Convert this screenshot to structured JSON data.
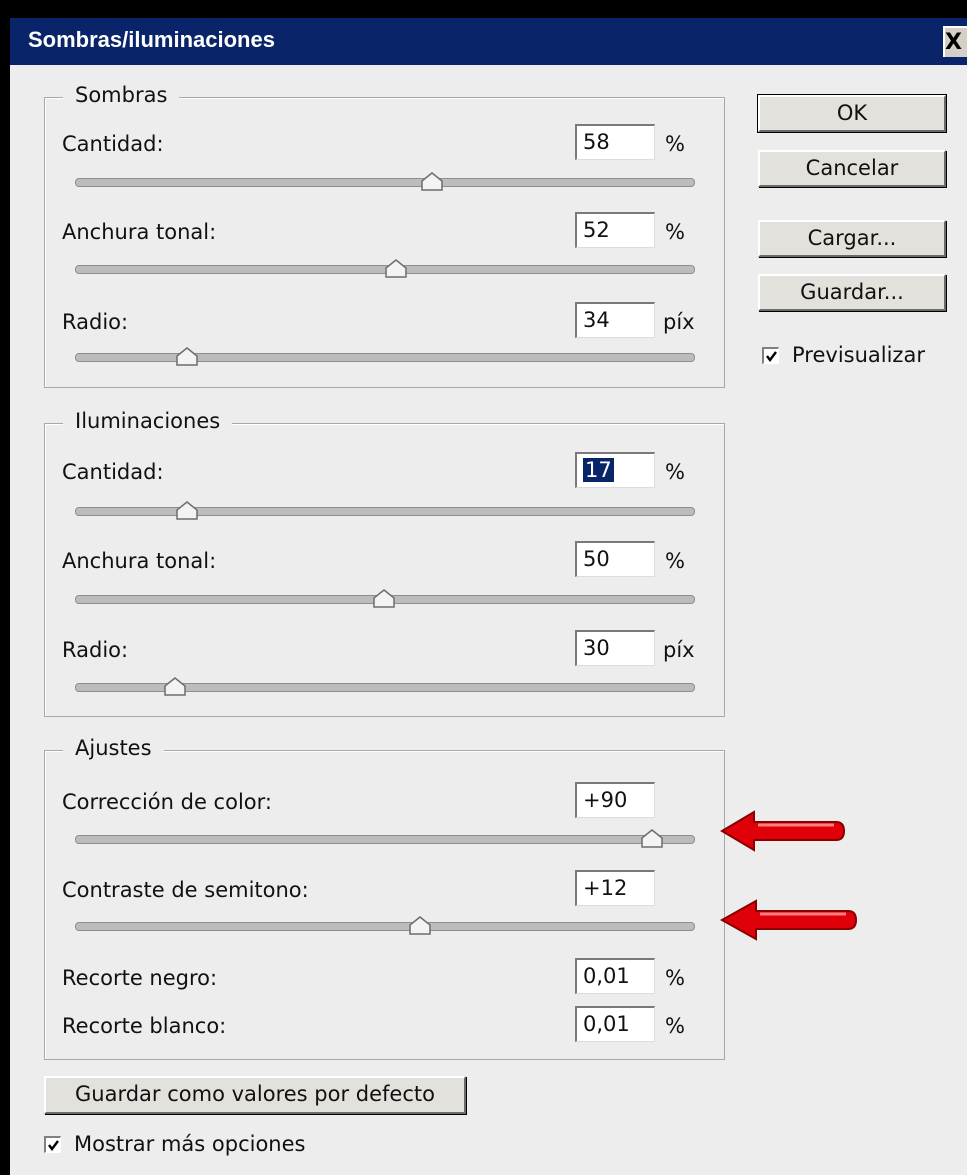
{
  "dialog": {
    "title": "Sombras/iluminaciones",
    "close_glyph": "X"
  },
  "sombras": {
    "legend": "Sombras",
    "cantidad": {
      "label": "Cantidad:",
      "value": "58",
      "unit": "%",
      "slider_fraction": 0.58
    },
    "anchura": {
      "label": "Anchura tonal:",
      "value": "52",
      "unit": "%",
      "slider_fraction": 0.52
    },
    "radio": {
      "label": "Radio:",
      "value": "34",
      "unit": "píx",
      "slider_fraction": 0.17
    }
  },
  "iluminaciones": {
    "legend": "Iluminaciones",
    "cantidad": {
      "label": "Cantidad:",
      "value": "17",
      "unit": "%",
      "slider_fraction": 0.17
    },
    "anchura": {
      "label": "Anchura tonal:",
      "value": "50",
      "unit": "%",
      "slider_fraction": 0.5
    },
    "radio": {
      "label": "Radio:",
      "value": "30",
      "unit": "píx",
      "slider_fraction": 0.15
    }
  },
  "ajustes": {
    "legend": "Ajustes",
    "correccion": {
      "label": "Corrección de color:",
      "value": "+90",
      "slider_fraction": 0.95
    },
    "contraste": {
      "label": "Contraste de semitono:",
      "value": "+12",
      "slider_fraction": 0.56
    },
    "recorte_negro": {
      "label": "Recorte negro:",
      "value": "0,01",
      "unit": "%"
    },
    "recorte_blanco": {
      "label": "Recorte blanco:",
      "value": "0,01",
      "unit": "%"
    }
  },
  "buttons": {
    "ok": "OK",
    "cancelar": "Cancelar",
    "cargar": "Cargar...",
    "guardar": "Guardar...",
    "guardar_defecto": "Guardar como valores por defecto"
  },
  "checkboxes": {
    "previsualizar": {
      "label": "Previsualizar",
      "checked": true
    },
    "mostrar_opciones": {
      "label": "Mostrar más opciones",
      "checked": true
    }
  },
  "colors": {
    "titlebar": "#0a246a",
    "annotation_arrow": "#e0000a"
  },
  "icons": {
    "annotation": "red-arrow-icon"
  }
}
